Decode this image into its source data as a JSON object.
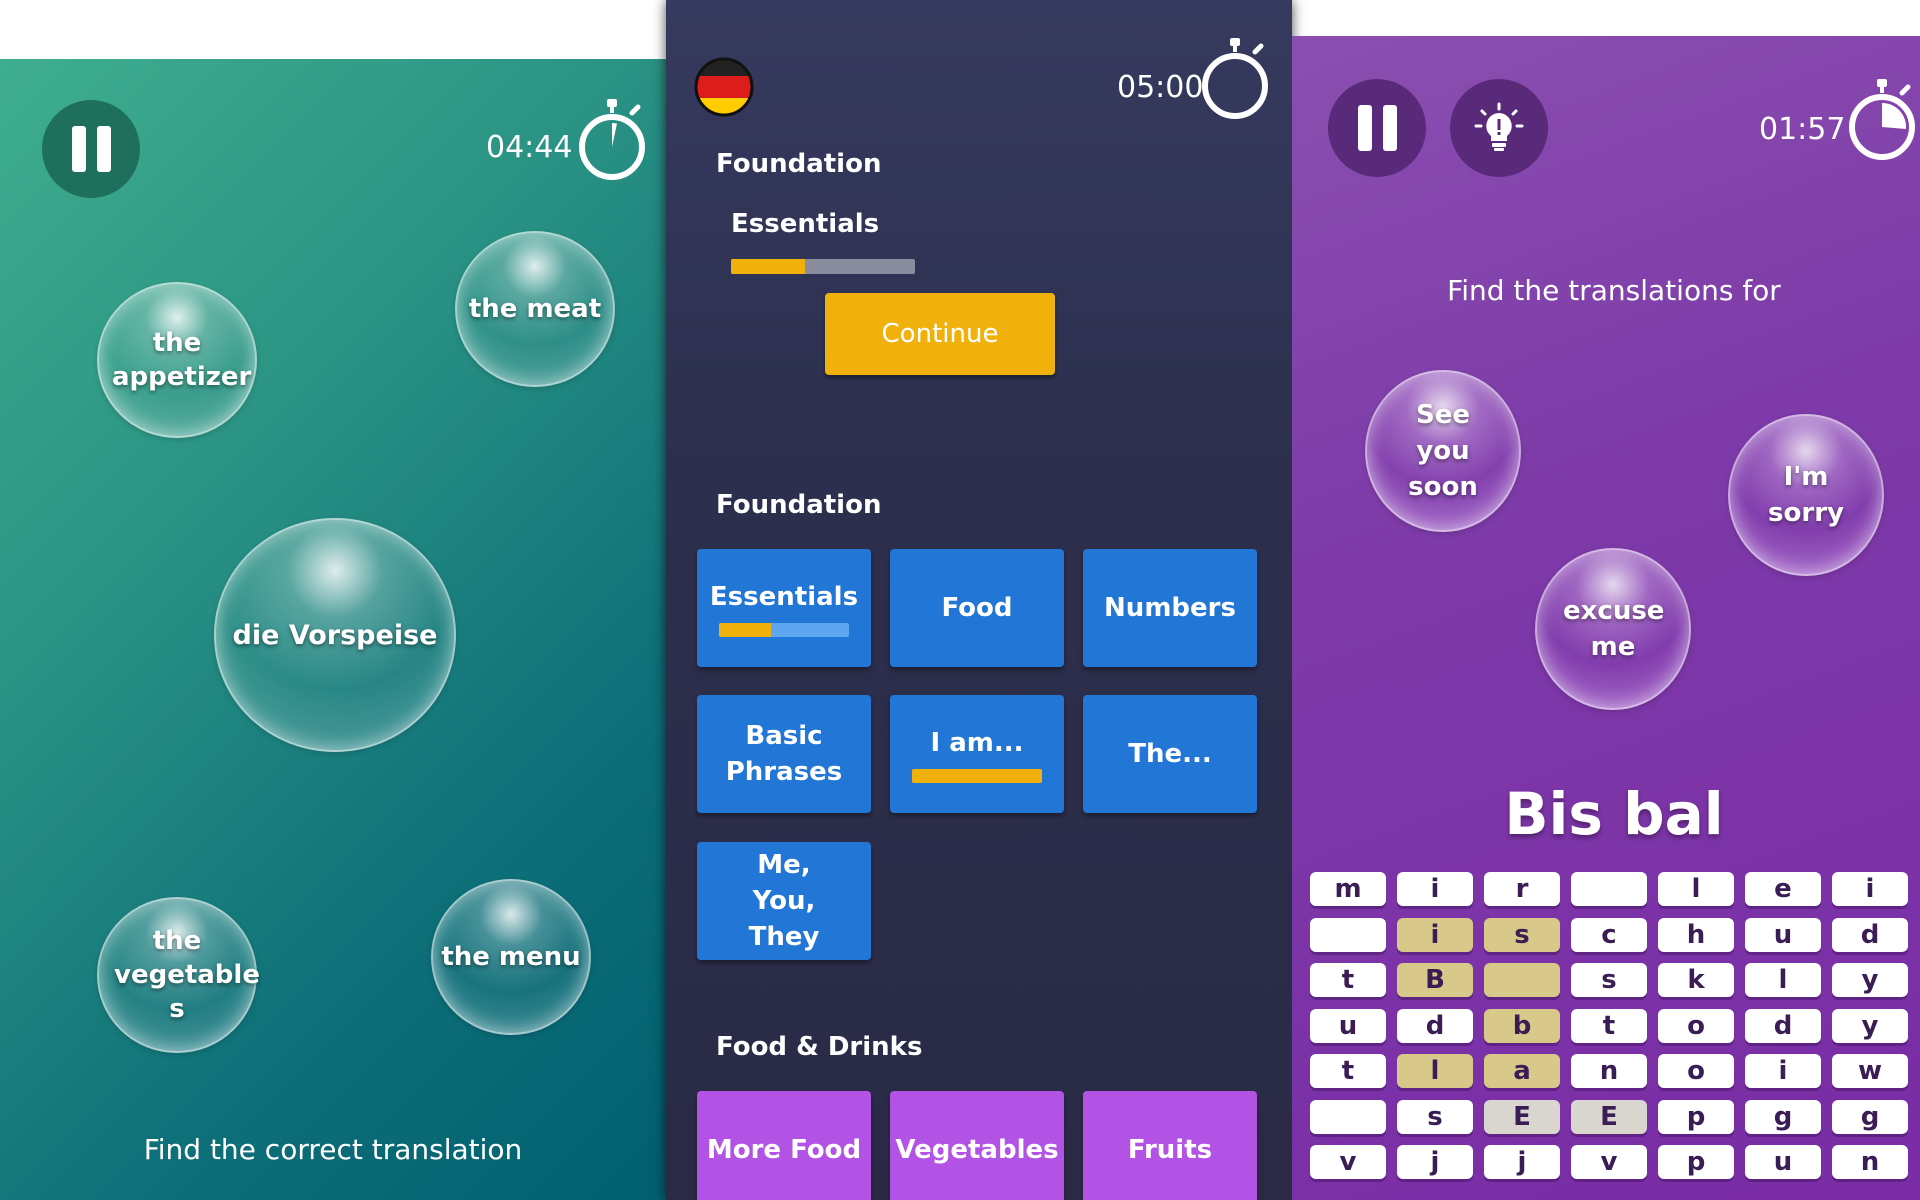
{
  "left": {
    "timer": "04:44",
    "bubbles": [
      {
        "label": "the appetizer"
      },
      {
        "label": "the meat"
      },
      {
        "label": "die Vorspeise"
      },
      {
        "label": "the vegetable s"
      },
      {
        "label": "the menu"
      }
    ],
    "footer": "Find the correct translation",
    "colors": {
      "accent": "#2a9384"
    }
  },
  "middle": {
    "flag": "german-flag",
    "timer": "05:00",
    "current": {
      "section": "Foundation",
      "lesson": "Essentials",
      "progress": 0.4,
      "button": "Continue"
    },
    "foundation": {
      "title": "Foundation",
      "tiles": [
        {
          "label": "Essentials",
          "progress": 0.4
        },
        {
          "label": "Food"
        },
        {
          "label": "Numbers"
        },
        {
          "label": "Basic Phrases"
        },
        {
          "label": "I am...",
          "progress": 1.0
        },
        {
          "label": "The..."
        },
        {
          "label": "Me, You, They"
        }
      ]
    },
    "food_drinks": {
      "title": "Food & Drinks",
      "tiles": [
        {
          "label": "More Food"
        },
        {
          "label": "Vegetables"
        },
        {
          "label": "Fruits"
        }
      ]
    },
    "colors": {
      "tile_blue": "#2277d6",
      "tile_purple": "#b253e6",
      "accent": "#f0b10c"
    }
  },
  "right": {
    "timer": "01:57",
    "prompt": "Find the translations for",
    "bubbles": [
      {
        "label": "See you soon"
      },
      {
        "label": "I'm sorry"
      },
      {
        "label": "excuse me"
      }
    ],
    "word": "Bis bal",
    "grid": [
      [
        "m",
        "i",
        "r",
        "",
        "l",
        "e",
        "i"
      ],
      [
        "",
        "i",
        "s",
        "c",
        "h",
        "u",
        "d"
      ],
      [
        "t",
        "B",
        "",
        "s",
        "k",
        "l",
        "y"
      ],
      [
        "u",
        "d",
        "b",
        "t",
        "o",
        "d",
        "y"
      ],
      [
        "t",
        "l",
        "a",
        "n",
        "o",
        "i",
        "w"
      ],
      [
        "",
        "s",
        "E",
        "E",
        "p",
        "g",
        "g"
      ],
      [
        "v",
        "j",
        "j",
        "v",
        "p",
        "u",
        "n"
      ]
    ],
    "selected": [
      [
        1,
        1
      ],
      [
        1,
        2
      ],
      [
        2,
        1
      ],
      [
        2,
        2
      ],
      [
        3,
        2
      ],
      [
        4,
        1
      ],
      [
        4,
        2
      ]
    ],
    "gray": [
      [
        5,
        2
      ],
      [
        5,
        3
      ]
    ],
    "colors": {
      "background": "#7d3aa8",
      "selected_cell": "#d8c98a"
    }
  }
}
